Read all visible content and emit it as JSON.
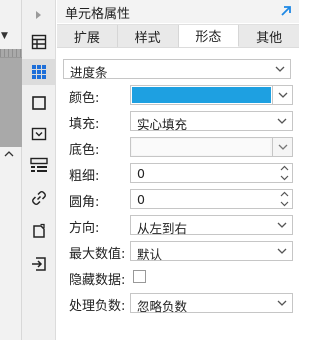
{
  "window": {
    "title": "单元格属性"
  },
  "tabs": [
    {
      "label": "扩展",
      "active": false
    },
    {
      "label": "样式",
      "active": false
    },
    {
      "label": "形态",
      "active": true
    },
    {
      "label": "其他",
      "active": false
    }
  ],
  "form": {
    "type_value": "进度条",
    "color_label": "颜色:",
    "color_value": "#1ea0e1",
    "fill_label": "填充:",
    "fill_value": "实心填充",
    "bgcolor_label": "底色:",
    "width_label": "粗细:",
    "width_value": "0",
    "radius_label": "圆角:",
    "radius_value": "0",
    "direction_label": "方向:",
    "direction_value": "从左到右",
    "max_label": "最大数值:",
    "max_value": "默认",
    "hide_label": "隐藏数据:",
    "hide_checked": false,
    "negative_label": "处理负数:",
    "negative_value": "忽略负数"
  },
  "rail_icons": [
    "chevron-right-icon",
    "table-icon",
    "grid-dots-icon",
    "square-icon",
    "dropdown-box-icon",
    "list-form-icon",
    "link-icon",
    "rotate-icon",
    "export-icon"
  ],
  "colors": {
    "accent": "#1ea0e1",
    "expand_arrow": "#1e88e5"
  }
}
